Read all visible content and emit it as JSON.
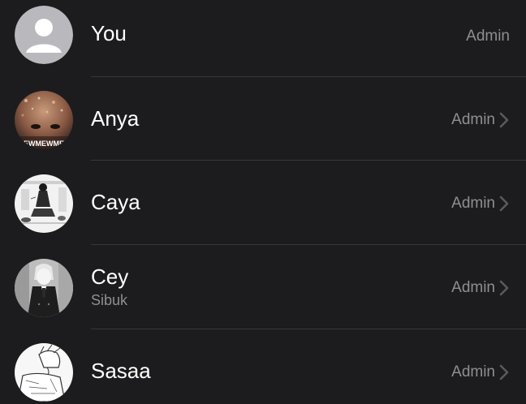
{
  "members": [
    {
      "name": "You",
      "status": "",
      "role": "Admin",
      "avatar_icon": "default-person-icon",
      "chevron": false
    },
    {
      "name": "Anya",
      "status": "",
      "role": "Admin",
      "avatar_icon": "photo-glitter-face",
      "avatar_text": "EWMEWME",
      "chevron": true
    },
    {
      "name": "Caya",
      "status": "",
      "role": "Admin",
      "avatar_icon": "photo-manga-scene",
      "chevron": true
    },
    {
      "name": "Cey",
      "status": "Sibuk",
      "role": "Admin",
      "avatar_icon": "photo-manga-character",
      "chevron": true
    },
    {
      "name": "Sasaa",
      "status": "",
      "role": "Admin",
      "avatar_icon": "photo-manga-sketch",
      "chevron": true
    }
  ],
  "colors": {
    "background": "#1c1c1e",
    "text_primary": "#ffffff",
    "text_secondary": "#8e8e93",
    "separator": "#38383a",
    "chevron": "#5a5a5e"
  }
}
